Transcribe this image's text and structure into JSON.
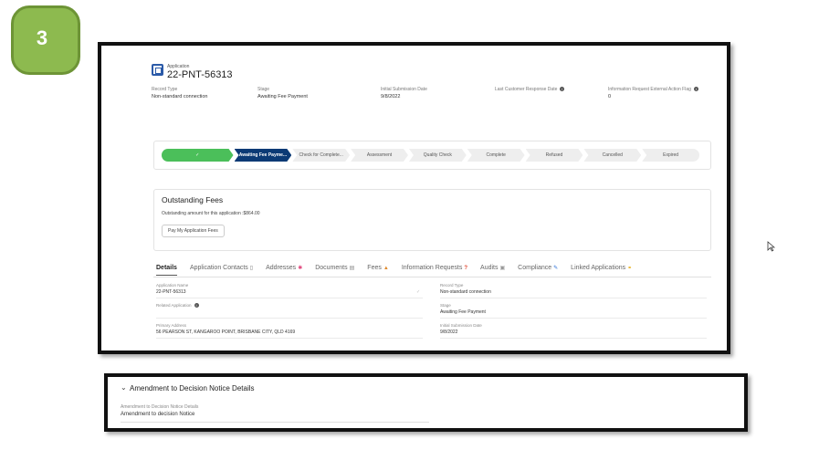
{
  "step_badge": "3",
  "application": {
    "type_label": "Application",
    "id": "22-PNT-56313"
  },
  "fields": [
    {
      "label": "Record Type",
      "value": "Non-standard connection"
    },
    {
      "label": "Stage",
      "value": "Awaiting Fee Payment"
    },
    {
      "label": "Initial Submission Date",
      "value": "9/8/2022"
    },
    {
      "label": "Last Customer Response Date",
      "value": ""
    },
    {
      "label": "Information Request External Action Flag",
      "value": "0"
    }
  ],
  "path": {
    "steps": [
      {
        "label": "✓",
        "status": "complete"
      },
      {
        "label": "Awaiting Fee Payme...",
        "status": "current"
      },
      {
        "label": "Check for Complete...",
        "status": "pending"
      },
      {
        "label": "Assessment",
        "status": "pending"
      },
      {
        "label": "Quality Check",
        "status": "pending"
      },
      {
        "label": "Complete",
        "status": "pending"
      },
      {
        "label": "Refused",
        "status": "pending"
      },
      {
        "label": "Cancelled",
        "status": "pending"
      },
      {
        "label": "Expired",
        "status": "pending"
      }
    ]
  },
  "fees": {
    "title": "Outstanding Fees",
    "amount_text": "Outstanding amount for this application :$864.00",
    "button": "Pay My Application Fees"
  },
  "tabs": [
    {
      "label": "Details",
      "icon": ""
    },
    {
      "label": "Application Contacts",
      "icon": "contacts-icon"
    },
    {
      "label": "Addresses",
      "icon": "asterisk-icon"
    },
    {
      "label": "Documents",
      "icon": "document-icon"
    },
    {
      "label": "Fees",
      "icon": "money-icon"
    },
    {
      "label": "Information Requests",
      "icon": "question-icon"
    },
    {
      "label": "Audits",
      "icon": "audit-icon"
    },
    {
      "label": "Compliance",
      "icon": "pencil-icon"
    },
    {
      "label": "Linked Applications",
      "icon": "link-icon"
    }
  ],
  "details": {
    "left": [
      {
        "label": "Application Name",
        "value": "22-PNT-56313"
      },
      {
        "label": "Related Application",
        "value": ""
      },
      {
        "label": "Primary Address",
        "value": "56 PEARSON ST, KANGAROO POINT, BRISBANE CITY, QLD 4169"
      }
    ],
    "right": [
      {
        "label": "Record Type",
        "value": "Non-standard connection"
      },
      {
        "label": "Stage",
        "value": "Awaiting Fee Payment"
      },
      {
        "label": "Initial Submission Date",
        "value": "9/8/2022"
      }
    ]
  },
  "amendment": {
    "section_title": "Amendment to Decision Notice Details",
    "field_label": "Amendment to Decision Notice Details",
    "field_value": "Amendment to decision Notice"
  },
  "colors": {
    "badge": "#8dba4f",
    "path_complete": "#4bbf5a",
    "path_current": "#0b3a75",
    "brand": "#2b5aa8"
  }
}
